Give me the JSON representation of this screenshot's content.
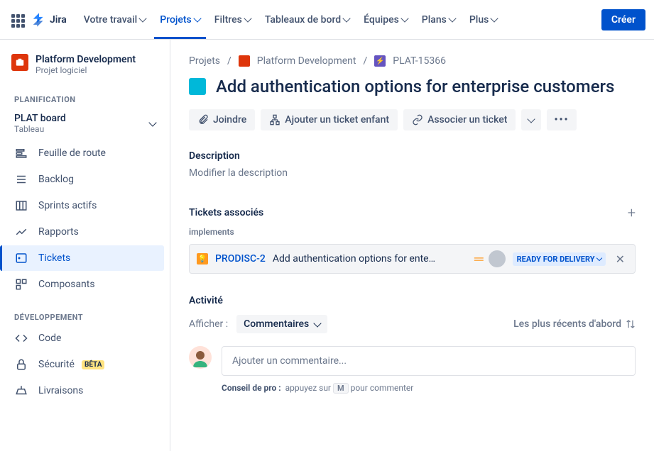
{
  "topnav": {
    "logo": "Jira",
    "items": [
      "Votre travail",
      "Projets",
      "Filtres",
      "Tableaux de bord",
      "Équipes",
      "Plans",
      "Plus"
    ],
    "active_index": 1,
    "create": "Créer"
  },
  "sidebar": {
    "project_name": "Platform Development",
    "project_type": "Projet logiciel",
    "section_planning": "PLANIFICATION",
    "board": {
      "name": "PLAT board",
      "sub": "Tableau"
    },
    "planning_items": [
      "Feuille de route",
      "Backlog",
      "Sprints actifs",
      "Rapports",
      "Tickets",
      "Composants"
    ],
    "selected_planning_index": 4,
    "section_dev": "DÉVELOPPEMENT",
    "dev_items": [
      "Code",
      "Sécurité",
      "Livraisons"
    ],
    "beta_label": "BÊTA"
  },
  "breadcrumb": {
    "root": "Projets",
    "project": "Platform Development",
    "key": "PLAT-15366"
  },
  "issue": {
    "title": "Add authentication options for enterprise customers",
    "actions": {
      "attach": "Joindre",
      "add_child": "Ajouter un ticket enfant",
      "link": "Associer un ticket"
    },
    "description_heading": "Description",
    "description_placeholder": "Modifier la description",
    "linked_heading": "Tickets associés",
    "implements_label": "implements",
    "linked": {
      "key": "PRODISC-2",
      "summary": "Add authentication options for ente…",
      "status": "READY FOR DELIVERY"
    }
  },
  "activity": {
    "heading": "Activité",
    "show_label": "Afficher :",
    "filter": "Commentaires",
    "sort": "Les plus récents d'abord",
    "comment_placeholder": "Ajouter un commentaire...",
    "tip_label": "Conseil de pro :",
    "tip_before": "appuyez sur",
    "tip_key": "M",
    "tip_after": "pour commenter"
  }
}
